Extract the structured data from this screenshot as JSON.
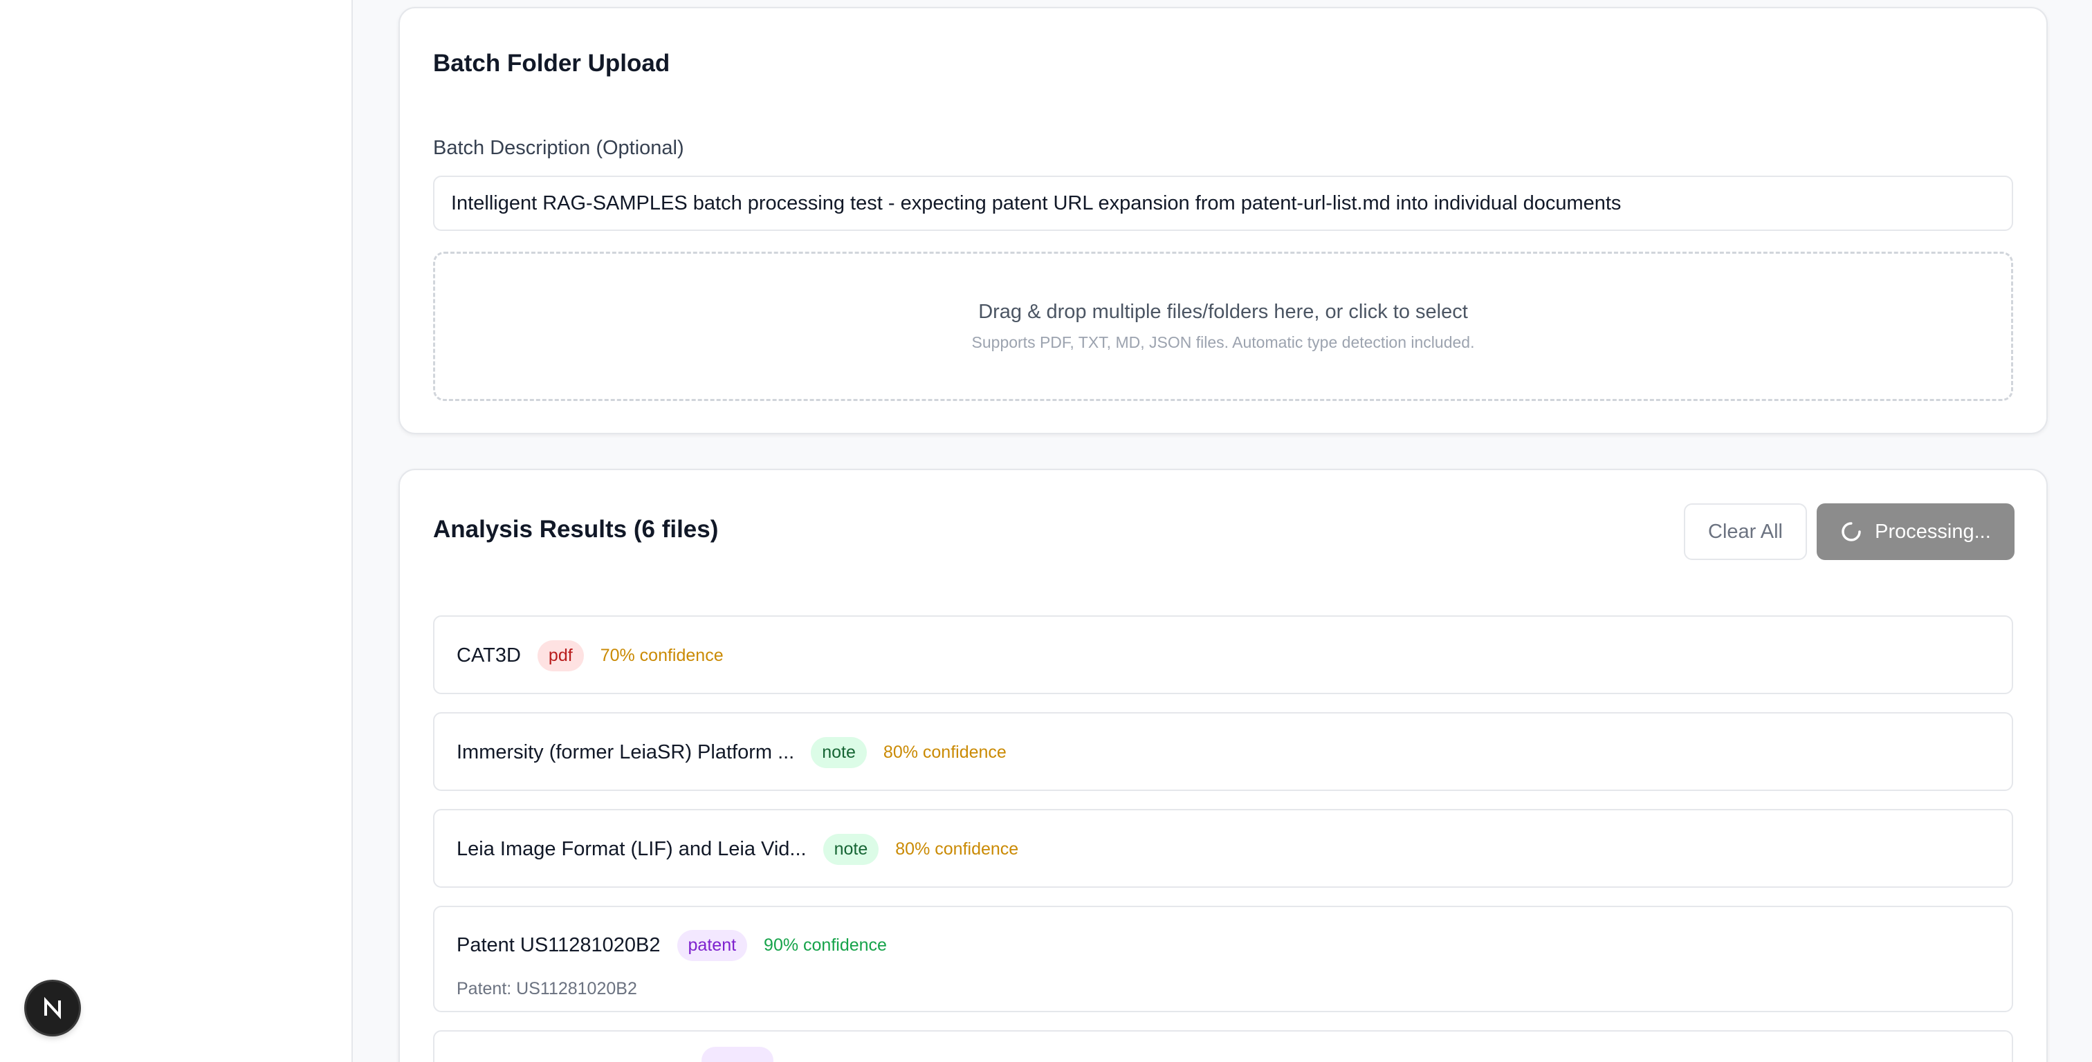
{
  "upload": {
    "title": "Batch Folder Upload",
    "description_label": "Batch Description (Optional)",
    "description_value": "Intelligent RAG-SAMPLES batch processing test - expecting patent URL expansion from patent-url-list.md into individual documents",
    "dropzone_main": "Drag & drop multiple files/folders here, or click to select",
    "dropzone_sub": "Supports PDF, TXT, MD, JSON files. Automatic type detection included."
  },
  "results": {
    "title": "Analysis Results (6 files)",
    "clear_label": "Clear All",
    "processing_label": "Processing...",
    "files": [
      {
        "name": "CAT3D",
        "type": "pdf",
        "confidence": "70% confidence"
      },
      {
        "name": "Immersity (former LeiaSR) Platform ...",
        "type": "note",
        "confidence": "80% confidence"
      },
      {
        "name": "Leia Image Format (LIF) and Leia Vid...",
        "type": "note",
        "confidence": "80% confidence"
      },
      {
        "name": "Patent US11281020B2",
        "type": "patent",
        "confidence": "90% confidence",
        "detail": "Patent: US11281020B2"
      },
      {
        "name": "",
        "type": "patent",
        "confidence": ""
      }
    ]
  },
  "colors": {
    "pdf_badge": "#fee2e2",
    "note_badge": "#dcfce7",
    "patent_badge": "#f3e8ff",
    "confidence_mid": "#ca8a04",
    "confidence_high": "#16a34a",
    "processing_button": "#8c8c8c"
  },
  "icons": {
    "spinner": "loading-spinner-icon",
    "nextjs": "nextjs-logo-icon"
  }
}
